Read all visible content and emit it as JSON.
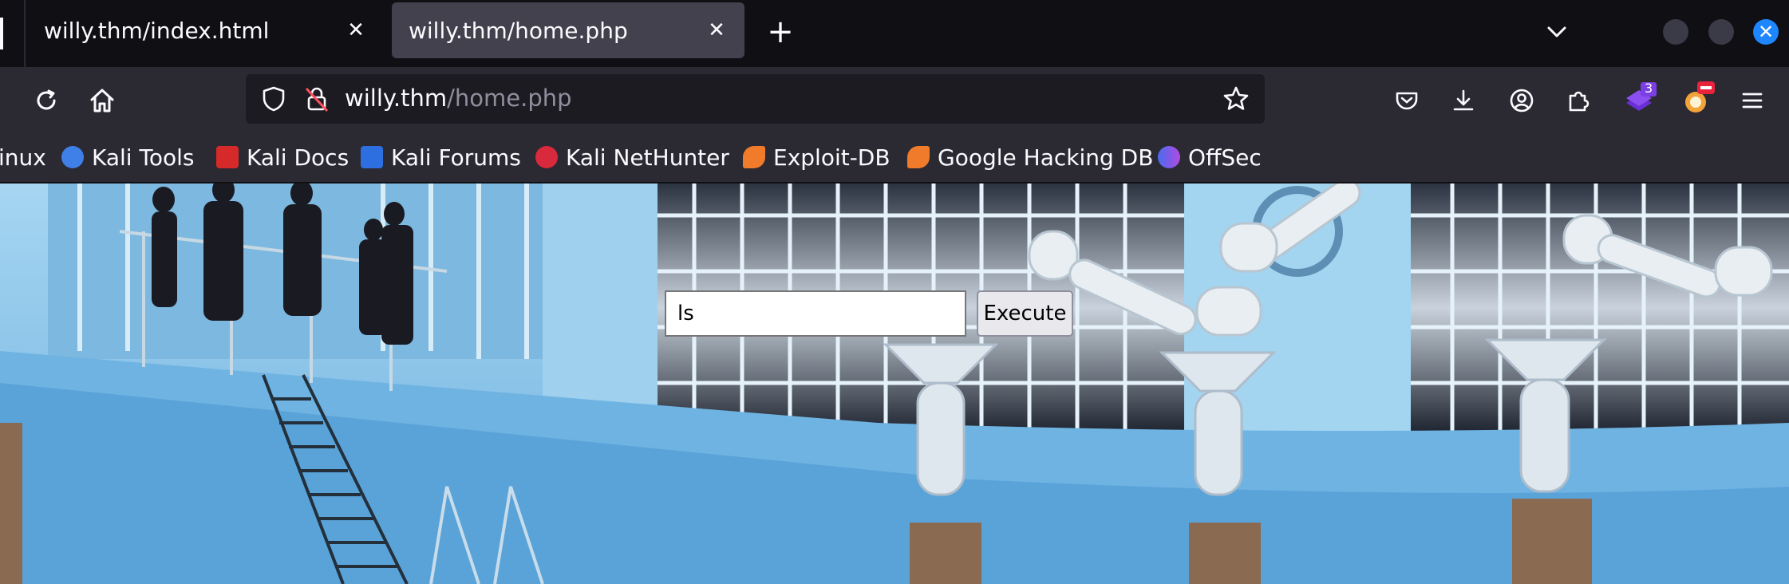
{
  "tabs": [
    {
      "title": "willy.thm/index.html",
      "active": false
    },
    {
      "title": "willy.thm/home.php",
      "active": true
    }
  ],
  "urlbar": {
    "host": "willy.thm",
    "path": "/home.php"
  },
  "extensions": {
    "badge_count": "3"
  },
  "bookmarks": [
    {
      "label": "inux",
      "icon": "kali-linux-icon"
    },
    {
      "label": "Kali Tools",
      "icon": "kali-tools-icon"
    },
    {
      "label": "Kali Docs",
      "icon": "kali-docs-icon"
    },
    {
      "label": "Kali Forums",
      "icon": "kali-forums-icon"
    },
    {
      "label": "Kali NetHunter",
      "icon": "kali-nethunter-icon"
    },
    {
      "label": "Exploit-DB",
      "icon": "exploit-db-icon"
    },
    {
      "label": "Google Hacking DB",
      "icon": "google-hacking-db-icon"
    },
    {
      "label": "OffSec",
      "icon": "offsec-icon"
    }
  ],
  "page": {
    "command_value": "ls",
    "execute_label": "Execute"
  },
  "colors": {
    "accent": "#1e86ff",
    "toolbar": "#2b2a33",
    "tabstrip": "#0f0f14"
  }
}
